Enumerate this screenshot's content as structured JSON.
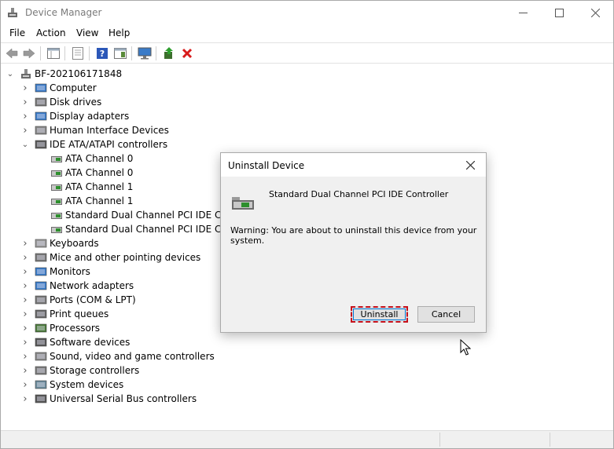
{
  "window": {
    "title": "Device Manager",
    "controls": {
      "minimize": "—",
      "maximize": "☐",
      "close": "✕"
    }
  },
  "menu": [
    "File",
    "Action",
    "View",
    "Help"
  ],
  "toolbar": {
    "icons": [
      "back-arrow-icon",
      "forward-arrow-icon",
      "properties-grid-icon",
      "driver-page-icon",
      "help-icon",
      "console-tree-icon",
      "monitor-scan-icon",
      "update-driver-icon",
      "uninstall-x-icon"
    ]
  },
  "tree": {
    "root": "BF-202106171848",
    "categories": [
      {
        "label": "Computer",
        "icon": "computer-icon"
      },
      {
        "label": "Disk drives",
        "icon": "disk-icon"
      },
      {
        "label": "Display adapters",
        "icon": "display-icon"
      },
      {
        "label": "Human Interface Devices",
        "icon": "hid-icon"
      },
      {
        "label": "IDE ATA/ATAPI controllers",
        "icon": "ide-icon",
        "expanded": true,
        "children": [
          "ATA Channel 0",
          "ATA Channel 0",
          "ATA Channel 1",
          "ATA Channel 1",
          "Standard Dual Channel PCI IDE Contr",
          "Standard Dual Channel PCI IDE Contr"
        ]
      },
      {
        "label": "Keyboards",
        "icon": "keyboard-icon"
      },
      {
        "label": "Mice and other pointing devices",
        "icon": "mouse-icon"
      },
      {
        "label": "Monitors",
        "icon": "monitor-icon"
      },
      {
        "label": "Network adapters",
        "icon": "network-icon"
      },
      {
        "label": "Ports (COM & LPT)",
        "icon": "port-icon"
      },
      {
        "label": "Print queues",
        "icon": "printer-icon"
      },
      {
        "label": "Processors",
        "icon": "processor-icon"
      },
      {
        "label": "Software devices",
        "icon": "software-device-icon"
      },
      {
        "label": "Sound, video and game controllers",
        "icon": "speaker-icon"
      },
      {
        "label": "Storage controllers",
        "icon": "storage-icon"
      },
      {
        "label": "System devices",
        "icon": "system-device-icon"
      },
      {
        "label": "Universal Serial Bus controllers",
        "icon": "usb-icon"
      }
    ]
  },
  "dialog": {
    "title": "Uninstall Device",
    "device_name": "Standard Dual Channel PCI IDE Controller",
    "warning": "Warning: You are about to uninstall this device from your system.",
    "uninstall_label": "Uninstall",
    "cancel_label": "Cancel"
  },
  "colors": {
    "highlight_border": "#c4101c",
    "focus_outline": "#0078d7"
  }
}
